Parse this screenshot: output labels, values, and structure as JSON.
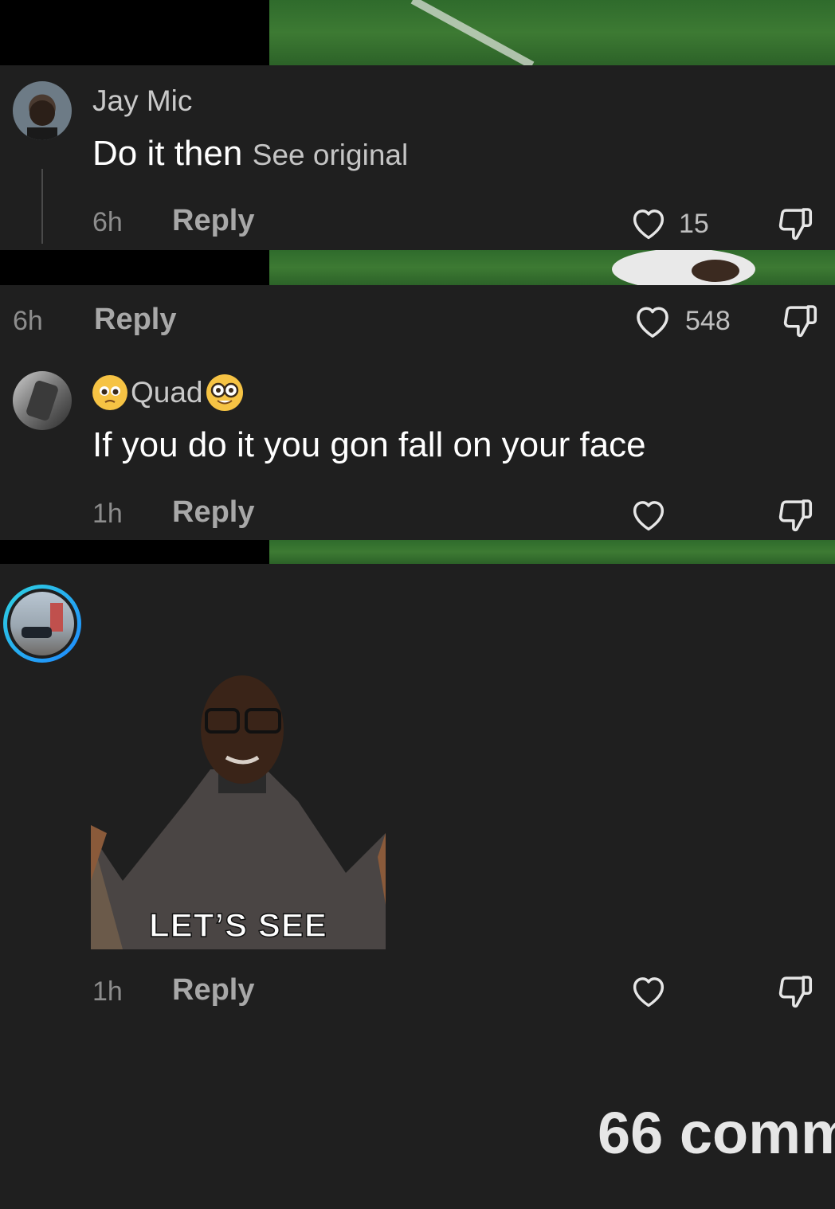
{
  "comments": [
    {
      "author": "Jay Mic",
      "text": "Do it then",
      "see_original": "See original",
      "time": "6h",
      "reply_label": "Reply",
      "likes": "15"
    },
    {
      "time": "6h",
      "reply_label": "Reply",
      "likes": "548"
    },
    {
      "author_name": "Quad",
      "text": "If you do it you gon fall on your face",
      "time": "1h",
      "reply_label": "Reply",
      "likes": ""
    },
    {
      "sticker_text": "LET’S SEE",
      "time": "1h",
      "reply_label": "Reply",
      "likes": ""
    }
  ],
  "footer": {
    "comment_count": "66 comm"
  },
  "icons": [
    "heart-icon",
    "dislike-icon",
    "pleading-face-emoji",
    "nerd-face-emoji"
  ],
  "colors": {
    "background": "#1f1f1f",
    "story_ring_start": "#2fd3e0",
    "story_ring_end": "#1e88ff"
  }
}
